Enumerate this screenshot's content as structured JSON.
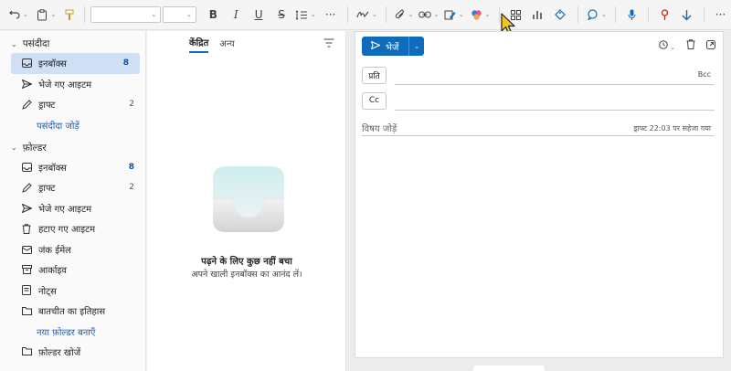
{
  "toolbar": {
    "icons": [
      "undo-icon",
      "paste-icon",
      "format-painter-icon",
      "bold-icon",
      "italic-icon",
      "underline-icon",
      "strikethrough-icon",
      "spacing-icon",
      "more-icon",
      "signature-icon",
      "attach-icon",
      "link-icon",
      "editor-icon",
      "copilot-icon",
      "apps-icon",
      "insights-icon",
      "tag-icon",
      "chat-icon",
      "dictate-icon",
      "sensitivity-icon",
      "download-icon",
      "more-icon"
    ],
    "bold": "B",
    "italic": "I",
    "underline": "U",
    "strike": "S",
    "more": "···"
  },
  "folders": {
    "favorites_title": "पसंदीदा",
    "favorites": [
      {
        "label": "इनबॉक्स",
        "count": "8",
        "icon": "inbox-icon"
      },
      {
        "label": "भेजे गए आइटम",
        "count": "",
        "icon": "send-icon"
      },
      {
        "label": "ड्राफ्ट",
        "count": "2",
        "icon": "draft-icon"
      }
    ],
    "add_favorite": "पसंदीदा जोड़ें",
    "folders_title": "फ़ोल्डर",
    "folders": [
      {
        "label": "इनबॉक्स",
        "count": "8",
        "icon": "inbox-icon"
      },
      {
        "label": "ड्राफ्ट",
        "count": "2",
        "icon": "draft-icon"
      },
      {
        "label": "भेजे गए आइटम",
        "count": "",
        "icon": "send-icon"
      },
      {
        "label": "हटाए गए आइटम",
        "count": "",
        "icon": "trash-icon"
      },
      {
        "label": "जंक ईमेल",
        "count": "",
        "icon": "junk-icon"
      },
      {
        "label": "आर्काइव",
        "count": "",
        "icon": "archive-icon"
      },
      {
        "label": "नोट्स",
        "count": "",
        "icon": "notes-icon"
      },
      {
        "label": "बातचीत का इतिहास",
        "count": "",
        "icon": "folder-icon"
      }
    ],
    "new_folder": "नया फ़ोल्डर बनाएँ",
    "search_folders": "फ़ोल्डर खोजें"
  },
  "message_list": {
    "tab_focused": "केंद्रित",
    "tab_other": "अन्य",
    "empty_title": "पढ़ने के लिए कुछ नहीं बचा",
    "empty_subtitle": "अपने खाली इनबॉक्स का आनंद लें।"
  },
  "compose": {
    "send_label": "भेजें",
    "to_label": "प्रति",
    "cc_label": "Cc",
    "bcc_label": "Bcc",
    "subject_placeholder": "विषय जोड़ें",
    "draft_note": "ड्राफ्ट 22:03 पर सहेजा गया"
  },
  "colors": {
    "accent": "#0f6cbd",
    "selected": "#cfe0f5",
    "count": "#0f4fa8"
  }
}
